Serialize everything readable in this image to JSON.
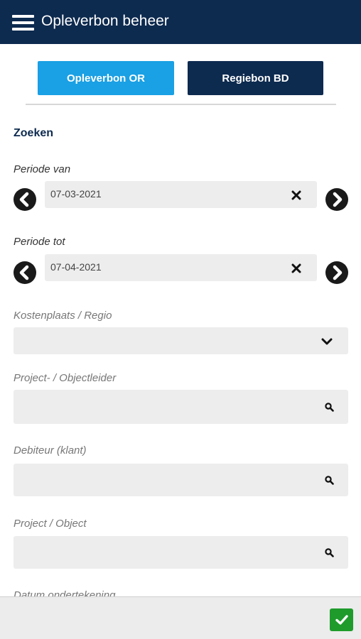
{
  "header": {
    "title": "Opleverbon beheer",
    "menu_icon": "hamburger-icon"
  },
  "tabs": [
    {
      "label": "Opleverbon OR",
      "color": "#1aa0e4",
      "active": true
    },
    {
      "label": "Regiebon BD",
      "color": "#0d2a4f",
      "active": false
    }
  ],
  "search": {
    "title": "Zoeken",
    "periode_van": {
      "label": "Periode van",
      "value": "07-03-2021"
    },
    "periode_tot": {
      "label": "Periode tot",
      "value": "07-04-2021"
    },
    "kostenplaats": {
      "label": "Kostenplaats / Regio",
      "value": ""
    },
    "projectleider": {
      "label": "Project- / Objectleider",
      "value": ""
    },
    "debiteur": {
      "label": "Debiteur (klant)",
      "value": ""
    },
    "project": {
      "label": "Project / Object",
      "value": ""
    },
    "datum_ondertekening": {
      "label": "Datum ondertekening"
    }
  },
  "colors": {
    "header": "#0d2a4f",
    "accent": "#1aa0e4",
    "confirm": "#1f9b2c"
  }
}
